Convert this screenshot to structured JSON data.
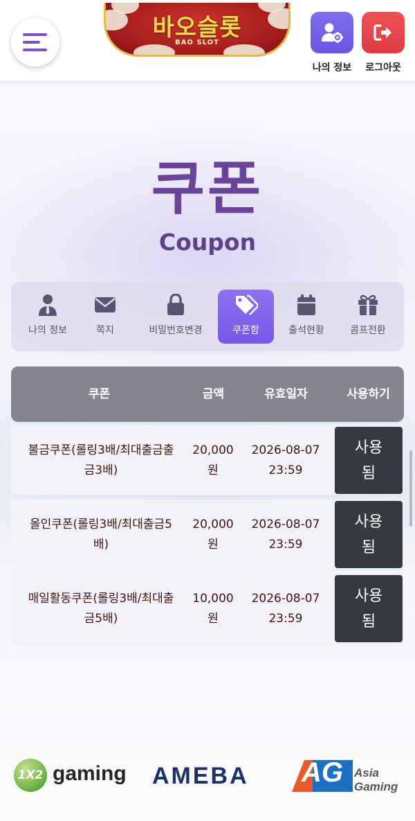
{
  "header": {
    "logo_text": "바오슬롯",
    "logo_sub": "BAO SLOT",
    "my_info_label": "나의 정보",
    "logout_label": "로그아웃"
  },
  "page": {
    "title_ko": "쿠폰",
    "title_en": "Coupon"
  },
  "tabs": [
    {
      "label": "나의 정보",
      "icon": "user-tie-icon",
      "active": false
    },
    {
      "label": "쪽지",
      "icon": "envelope-icon",
      "active": false
    },
    {
      "label": "비밀번호변경",
      "icon": "lock-icon",
      "active": false
    },
    {
      "label": "쿠폰함",
      "icon": "tags-icon",
      "active": true
    },
    {
      "label": "출석현황",
      "icon": "calendar-icon",
      "active": false
    },
    {
      "label": "콤프전환",
      "icon": "gift-icon",
      "active": false
    }
  ],
  "table": {
    "columns": [
      "쿠폰",
      "금액",
      "유효일자",
      "사용하기"
    ],
    "rows": [
      {
        "name": "불금쿠폰(롤링3배/최대출금출금3배)",
        "amount": "20,000원",
        "date": "2026-08-07 23:59",
        "action": "사용됨"
      },
      {
        "name": "올인쿠폰(롤링3배/최대출금5배)",
        "amount": "20,000원",
        "date": "2026-08-07 23:59",
        "action": "사용됨"
      },
      {
        "name": "매일활동쿠폰(롤링3배/최대출금5배)",
        "amount": "10,000원",
        "date": "2026-08-07 23:59",
        "action": "사용됨"
      }
    ],
    "display": {
      "rows": [
        {
          "name_1": "불금쿠폰(롤링3배/최대출금출",
          "name_2": "금3배)",
          "amount_1": "20,000",
          "amount_2": "원",
          "date_1": "2026-08-07",
          "date_2": "23:59",
          "action_1": "사용",
          "action_2": "됨"
        },
        {
          "name_1": "올인쿠폰(롤링3배/최대출금5",
          "name_2": "배)",
          "amount_1": "20,000",
          "amount_2": "원",
          "date_1": "2026-08-07",
          "date_2": "23:59",
          "action_1": "사용",
          "action_2": "됨"
        },
        {
          "name_1": "매일활동쿠폰(롤링3배/최대출",
          "name_2": "금5배)",
          "amount_1": "10,000",
          "amount_2": "원",
          "date_1": "2026-08-07",
          "date_2": "23:59",
          "action_1": "사용",
          "action_2": "됨"
        }
      ]
    }
  },
  "footer": {
    "providers": [
      {
        "ball": "1X2",
        "text": "gaming"
      },
      {
        "text": "AMEBA"
      },
      {
        "mark": "AG",
        "text_1": "Asia",
        "text_2": "Gaming"
      }
    ]
  },
  "colors": {
    "accent": "#7457e6",
    "title": "#6a4597",
    "table_header": "#86848f",
    "use_button": "#343a40",
    "logout": "#dd3b42"
  }
}
